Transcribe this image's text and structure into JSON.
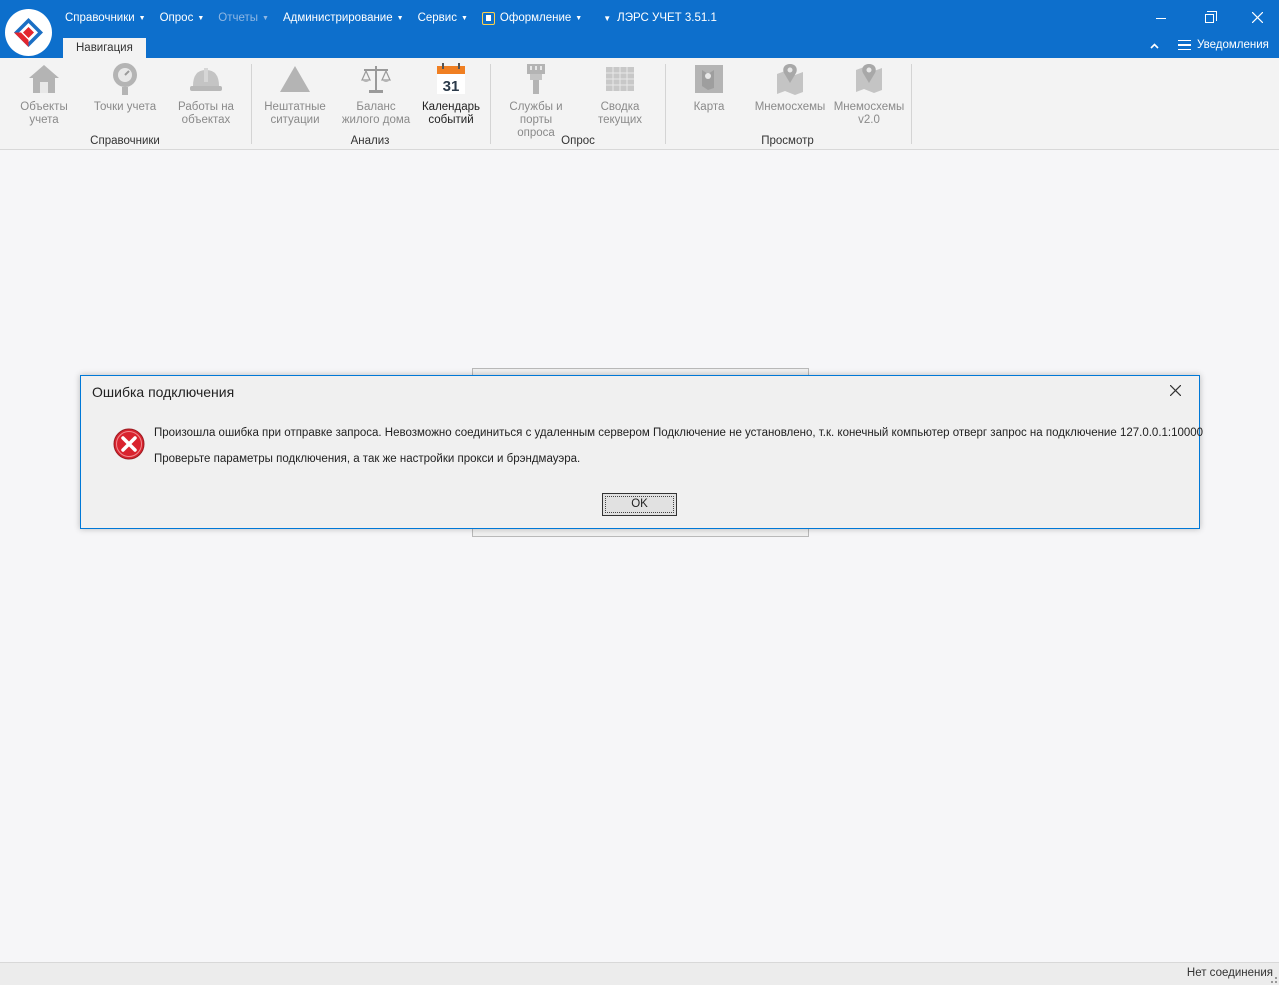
{
  "window": {
    "app_title": "ЛЭРС УЧЕТ 3.51.1",
    "controls": {
      "minimize_icon": "minimize-icon",
      "restore_icon": "restore-icon",
      "close_icon": "close-icon"
    }
  },
  "menu": {
    "items": [
      {
        "label": "Справочники",
        "enabled": true
      },
      {
        "label": "Опрос",
        "enabled": true
      },
      {
        "label": "Отчеты",
        "enabled": false
      },
      {
        "label": "Администрирование",
        "enabled": true
      },
      {
        "label": "Сервис",
        "enabled": true
      },
      {
        "label": "Оформление",
        "enabled": true
      }
    ]
  },
  "tabs": {
    "active": "Навигация"
  },
  "header_right": {
    "notifications_label": "Уведомления"
  },
  "ribbon": {
    "groups": [
      {
        "label": "Справочники"
      },
      {
        "label": "Анализ"
      },
      {
        "label": "Опрос"
      },
      {
        "label": "Просмотр"
      }
    ],
    "buttons": [
      {
        "label": "Объекты учета",
        "icon": "house-icon",
        "enabled": false
      },
      {
        "label": "Точки учета",
        "icon": "meter-point-icon",
        "enabled": false
      },
      {
        "label": "Работы на объектах",
        "icon": "hardhat-icon",
        "enabled": false
      },
      {
        "label": "Нештатные ситуации",
        "icon": "warning-icon",
        "enabled": false
      },
      {
        "label": "Баланс жилого дома",
        "icon": "scales-icon",
        "enabled": false
      },
      {
        "label": "Календарь событий",
        "icon": "calendar-icon",
        "enabled": true,
        "calendar_day": "31"
      },
      {
        "label": "Службы и порты опроса",
        "icon": "connector-icon",
        "enabled": false
      },
      {
        "label": "Сводка текущих",
        "icon": "grid-table-icon",
        "enabled": false
      },
      {
        "label": "Карта",
        "icon": "map-icon",
        "enabled": false
      },
      {
        "label": "Мнемосхемы",
        "icon": "map-pin-icon",
        "enabled": false
      },
      {
        "label": "Мнемосхемы v2.0",
        "icon": "map-pin-v2-icon",
        "enabled": false
      }
    ]
  },
  "dialog": {
    "title": "Ошибка подключения",
    "message_line1": "Произошла ошибка при отправке запроса. Невозможно соединиться с удаленным сервером Подключение не установлено, т.к. конечный компьютер отверг запрос на подключение 127.0.0.1:10000",
    "message_line2": "Проверьте параметры подключения, а так же настройки прокси и брэндмауэра.",
    "ok_label": "OK"
  },
  "statusbar": {
    "text": "Нет соединения"
  },
  "colors": {
    "title_bar": "#0d6fcc",
    "ribbon_bg": "#f3f3f3",
    "workspace": "#f6f6f8",
    "dialog_border": "#0078d7",
    "error_red": "#d9232e",
    "calendar_orange": "#f07f22"
  }
}
